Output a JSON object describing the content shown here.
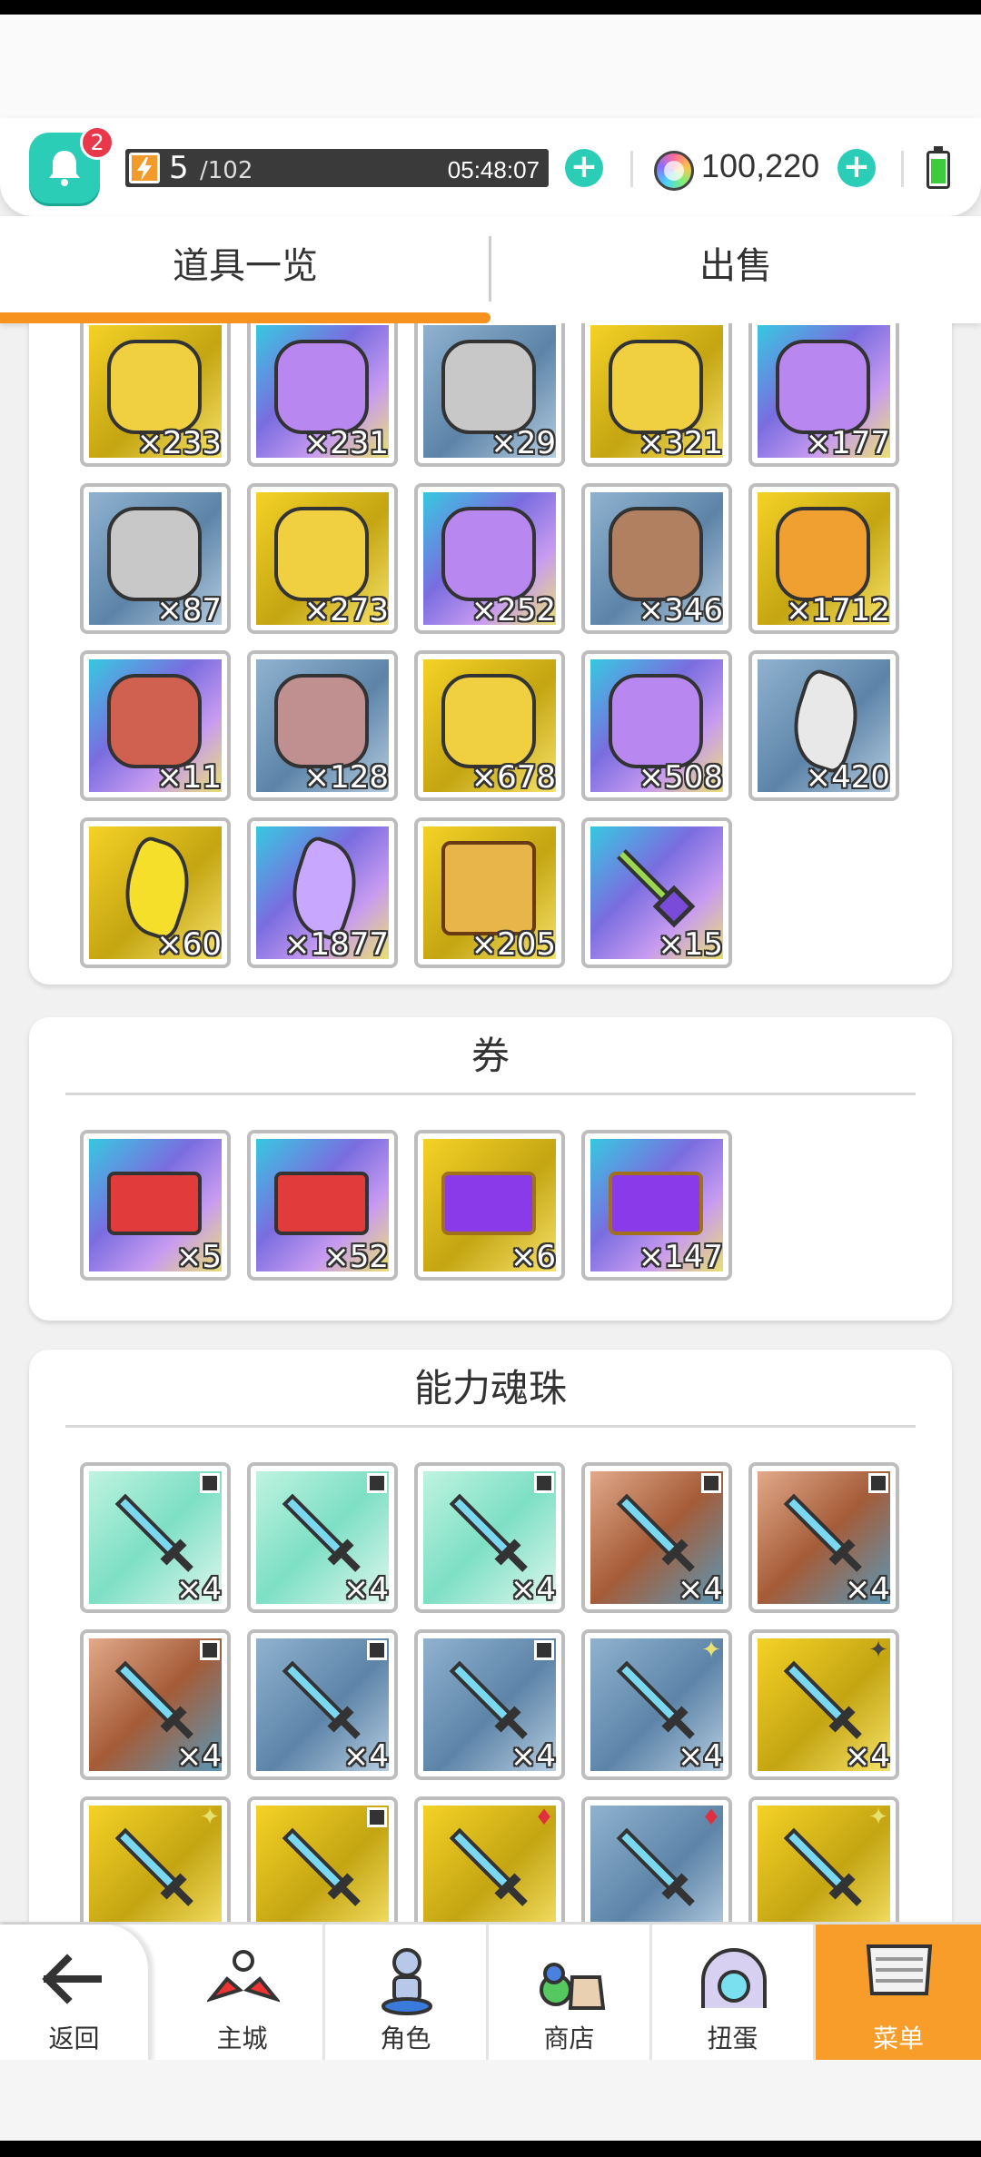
{
  "header": {
    "notification_count": "2",
    "stamina_current": "5",
    "stamina_max": "/102",
    "stamina_timer": "05:48:07",
    "gems": "100,220"
  },
  "tabs": [
    {
      "label": "道具一览",
      "active": true
    },
    {
      "label": "出售",
      "active": false
    }
  ],
  "sections": {
    "materials": {
      "items": [
        {
          "qty": "×233",
          "bg": "gold",
          "icon": "gold-wing-coin-icon"
        },
        {
          "qty": "×231",
          "bg": "purple",
          "icon": "purple-wing-coin-icon"
        },
        {
          "qty": "×29",
          "bg": "silver",
          "icon": "silver-beast-coin-icon"
        },
        {
          "qty": "×321",
          "bg": "gold",
          "icon": "gold-beast-coin-icon"
        },
        {
          "qty": "×177",
          "bg": "purple",
          "icon": "purple-beast-coin-icon"
        },
        {
          "qty": "×87",
          "bg": "silver",
          "icon": "silver-bird-coin-icon"
        },
        {
          "qty": "×273",
          "bg": "gold",
          "icon": "gold-bird-coin-icon"
        },
        {
          "qty": "×252",
          "bg": "purple",
          "icon": "purple-bird-coin-icon"
        },
        {
          "qty": "×346",
          "bg": "silver",
          "icon": "bronze-bird-coin-icon"
        },
        {
          "qty": "×1712",
          "bg": "gold",
          "icon": "orange-bird-coin-icon"
        },
        {
          "qty": "×11",
          "bg": "purple",
          "icon": "red-crest-coin-icon"
        },
        {
          "qty": "×128",
          "bg": "silver",
          "icon": "pink-skull-coin-icon"
        },
        {
          "qty": "×678",
          "bg": "gold",
          "icon": "gold-skull-coin-icon"
        },
        {
          "qty": "×508",
          "bg": "purple",
          "icon": "purple-skull-coin-icon"
        },
        {
          "qty": "×420",
          "bg": "silver",
          "icon": "white-shard-icon"
        },
        {
          "qty": "×60",
          "bg": "gold",
          "icon": "gold-shard-icon"
        },
        {
          "qty": "×1877",
          "bg": "purple",
          "icon": "purple-crystal-icon"
        },
        {
          "qty": "×205",
          "bg": "gold",
          "icon": "scroll-icon"
        },
        {
          "qty": "×15",
          "bg": "purple",
          "icon": "key-icon"
        }
      ]
    },
    "tickets": {
      "title": "券",
      "items": [
        {
          "qty": "×5",
          "bg": "purple",
          "icon": "red-ticket-stack-icon"
        },
        {
          "qty": "×52",
          "bg": "purple",
          "icon": "red-ticket-icon"
        },
        {
          "qty": "×6",
          "bg": "gold",
          "icon": "purple-ticket-stack-icon"
        },
        {
          "qty": "×147",
          "bg": "purple",
          "icon": "purple-ticket-icon"
        }
      ]
    },
    "orbs": {
      "title": "能力魂珠",
      "items": [
        {
          "qty": "×4",
          "bg": "teal",
          "icon": "sword-orb-icon",
          "mark": "square"
        },
        {
          "qty": "×4",
          "bg": "teal",
          "icon": "staff-orb-icon",
          "mark": "square"
        },
        {
          "qty": "×4",
          "bg": "teal",
          "icon": "shield-orb-icon",
          "mark": "square"
        },
        {
          "qty": "×4",
          "bg": "copper",
          "icon": "greatsword-orb-icon",
          "mark": "square"
        },
        {
          "qty": "×4",
          "bg": "copper",
          "icon": "bow-orb-icon",
          "mark": "square"
        },
        {
          "qty": "×4",
          "bg": "copper",
          "icon": "gauntlet-orb-icon",
          "mark": "square"
        },
        {
          "qty": "×4",
          "bg": "silver",
          "icon": "axe-orb-icon",
          "mark": "square"
        },
        {
          "qty": "×4",
          "bg": "silver",
          "icon": "spear-orb-icon",
          "mark": "square"
        },
        {
          "qty": "×4",
          "bg": "silver",
          "icon": "ice-sword-orb-icon",
          "mark": "spark"
        },
        {
          "qty": "×4",
          "bg": "gold",
          "icon": "crystal-sword-orb-icon",
          "mark": "dspark"
        },
        {
          "qty": "",
          "bg": "gold",
          "icon": "lance-orb-icon",
          "mark": "spark"
        },
        {
          "qty": "",
          "bg": "gold",
          "icon": "battle-axe-orb-icon",
          "mark": "square"
        },
        {
          "qty": "",
          "bg": "gold",
          "icon": "spear-gold-orb-icon",
          "mark": "red"
        },
        {
          "qty": "",
          "bg": "silver",
          "icon": "tablet-orb-icon",
          "mark": "red"
        },
        {
          "qty": "",
          "bg": "gold",
          "icon": "wing-shield-orb-icon",
          "mark": "spark"
        }
      ]
    }
  },
  "nav": [
    {
      "label": "返回",
      "icon": "back-arrow-icon"
    },
    {
      "label": "主城",
      "icon": "castle-icon"
    },
    {
      "label": "角色",
      "icon": "character-icon"
    },
    {
      "label": "商店",
      "icon": "shop-icon"
    },
    {
      "label": "扭蛋",
      "icon": "gacha-icon"
    },
    {
      "label": "菜单",
      "icon": "menu-icon",
      "active": true
    }
  ],
  "colors": {
    "accent": "#2ccdb7",
    "tab_underline": "#f7921e",
    "nav_active": "#f89c2a",
    "badge": "#e8384a"
  }
}
